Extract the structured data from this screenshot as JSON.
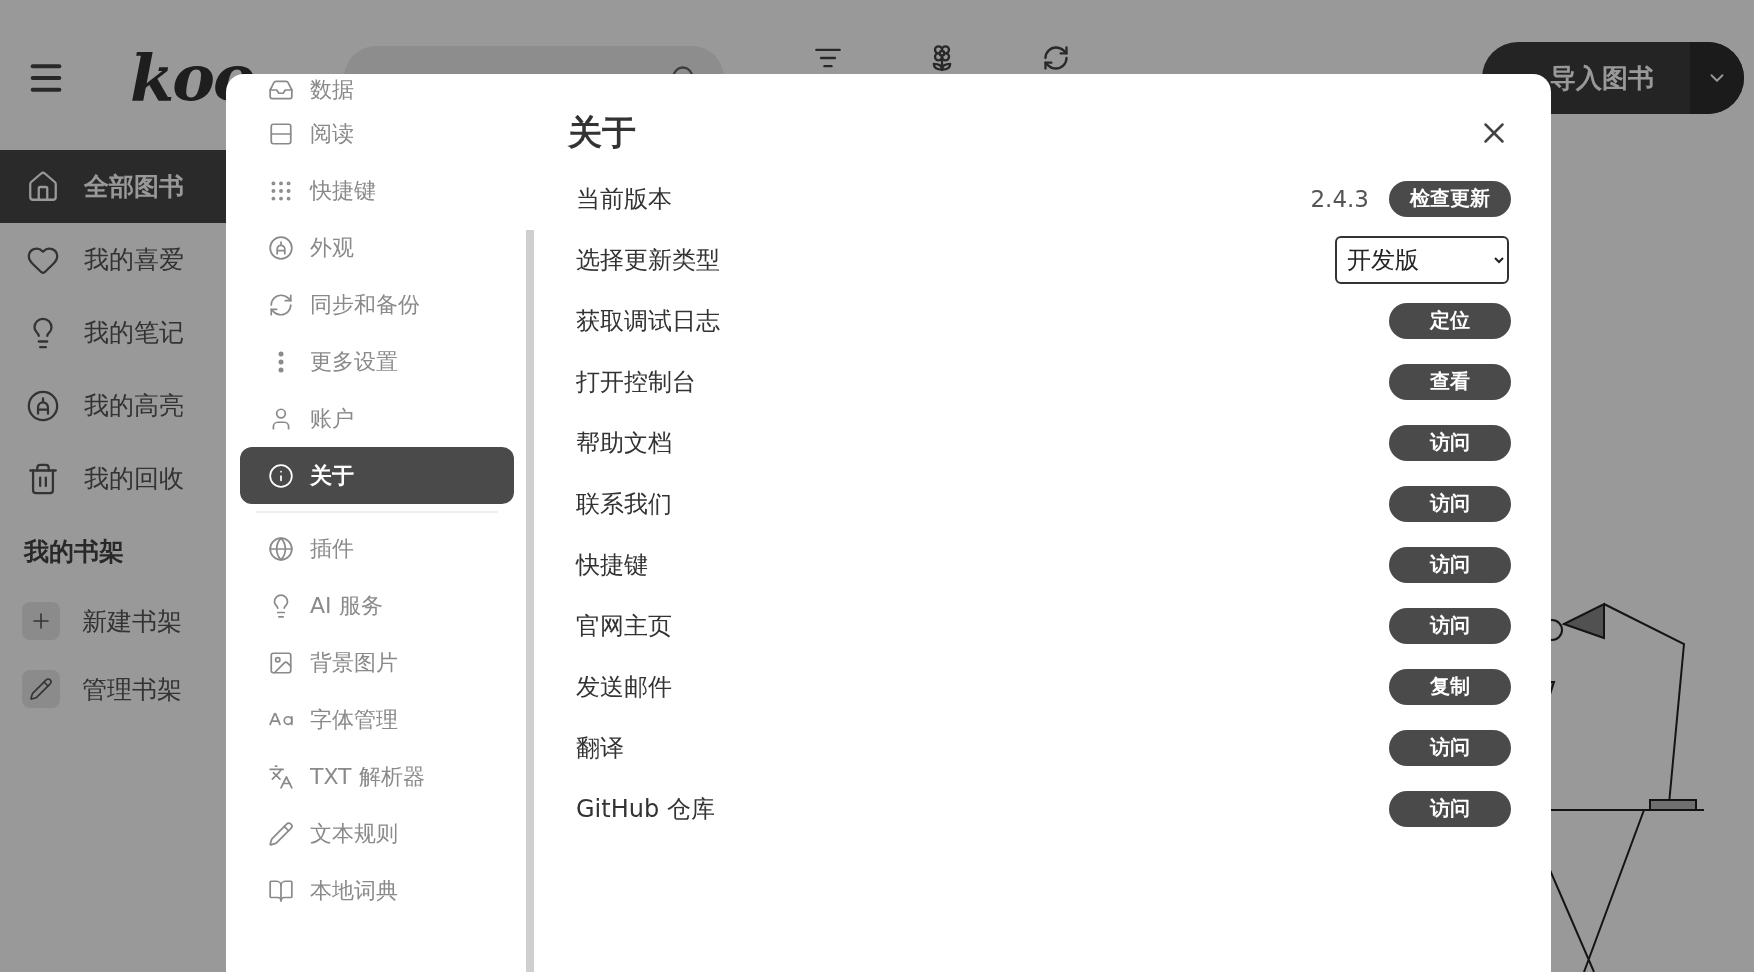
{
  "app": {
    "logo": "koo",
    "import_button": "导入图书"
  },
  "sidebar": {
    "items": [
      {
        "label": "全部图书",
        "kind": "home",
        "selected": true
      },
      {
        "label": "我的喜爱",
        "kind": "heart",
        "selected": false
      },
      {
        "label": "我的笔记",
        "kind": "bulb",
        "selected": false
      },
      {
        "label": "我的高亮",
        "kind": "highlight",
        "selected": false
      },
      {
        "label": "我的回收",
        "kind": "trash",
        "selected": false
      }
    ],
    "shelf_heading": "我的书架",
    "shelf_actions": [
      {
        "label": "新建书架",
        "kind": "plus"
      },
      {
        "label": "管理书架",
        "kind": "pencil"
      }
    ]
  },
  "dialog": {
    "nav_groups": [
      {
        "items": [
          {
            "label": "数据",
            "kind": "data",
            "selected": false
          },
          {
            "label": "阅读",
            "kind": "reading",
            "selected": false
          },
          {
            "label": "快捷键",
            "kind": "keys",
            "selected": false
          },
          {
            "label": "外观",
            "kind": "highlight",
            "selected": false
          },
          {
            "label": "同步和备份",
            "kind": "sync",
            "selected": false
          },
          {
            "label": "更多设置",
            "kind": "more",
            "selected": false
          },
          {
            "label": "账户",
            "kind": "user",
            "selected": false
          },
          {
            "label": "关于",
            "kind": "info",
            "selected": true
          }
        ]
      },
      {
        "items": [
          {
            "label": "插件",
            "kind": "globe",
            "selected": false
          },
          {
            "label": "AI 服务",
            "kind": "bulb",
            "selected": false
          },
          {
            "label": "背景图片",
            "kind": "image",
            "selected": false
          },
          {
            "label": "字体管理",
            "kind": "font",
            "selected": false
          },
          {
            "label": "TXT 解析器",
            "kind": "parser",
            "selected": false
          },
          {
            "label": "文本规则",
            "kind": "pencil",
            "selected": false
          },
          {
            "label": "本地词典",
            "kind": "book",
            "selected": false
          }
        ]
      }
    ],
    "title": "关于",
    "rows": [
      {
        "label": "当前版本",
        "kind": "version",
        "value": "2.4.3",
        "button": "检查更新"
      },
      {
        "label": "选择更新类型",
        "kind": "select",
        "value": "开发版"
      },
      {
        "label": "获取调试日志",
        "kind": "button",
        "button": "定位"
      },
      {
        "label": "打开控制台",
        "kind": "button",
        "button": "查看"
      },
      {
        "label": "帮助文档",
        "kind": "button",
        "button": "访问"
      },
      {
        "label": "联系我们",
        "kind": "button",
        "button": "访问"
      },
      {
        "label": "快捷键",
        "kind": "button",
        "button": "访问"
      },
      {
        "label": "官网主页",
        "kind": "button",
        "button": "访问"
      },
      {
        "label": "发送邮件",
        "kind": "button",
        "button": "复制"
      },
      {
        "label": "翻译",
        "kind": "button",
        "button": "访问"
      },
      {
        "label": "GitHub 仓库",
        "kind": "button",
        "button": "访问"
      }
    ]
  }
}
